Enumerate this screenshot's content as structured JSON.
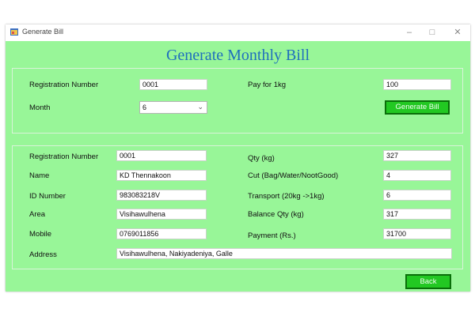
{
  "window": {
    "title": "Generate Bill",
    "minimize": "–",
    "maximize": "□",
    "close": "✕"
  },
  "heading": "Generate Monthly Bill",
  "top_form": {
    "reg_label": "Registration Number",
    "reg_value": "0001",
    "pay_label": "Pay for 1kg",
    "pay_value": "100",
    "month_label": "Month",
    "month_value": "6",
    "generate_button": "Generate Bill"
  },
  "details": {
    "reg_label": "Registration Number",
    "reg_value": "0001",
    "name_label": "Name",
    "name_value": "KD Thennakoon",
    "id_label": "ID Number",
    "id_value": "983083218V",
    "area_label": "Area",
    "area_value": "Visihawulhena",
    "mobile_label": "Mobile",
    "mobile_value": "0769011856",
    "address_label": "Address",
    "address_value": "Visihawulhena, Nakiyadeniya, Galle",
    "qty_label": "Qty (kg)",
    "qty_value": "327",
    "cut_label": "Cut (Bag/Water/NootGood)",
    "cut_value": "4",
    "transport_label": "Transport (20kg ->1kg)",
    "transport_value": "6",
    "balance_label": "Balance Qty (kg)",
    "balance_value": "317",
    "payment_label": "Payment (Rs.)",
    "payment_value": "31700"
  },
  "back_button": "Back",
  "colors": {
    "window_bg": "#98f698",
    "heading": "#1f6fbd",
    "button_bg": "#22c822",
    "button_border": "#0a6f0a"
  }
}
